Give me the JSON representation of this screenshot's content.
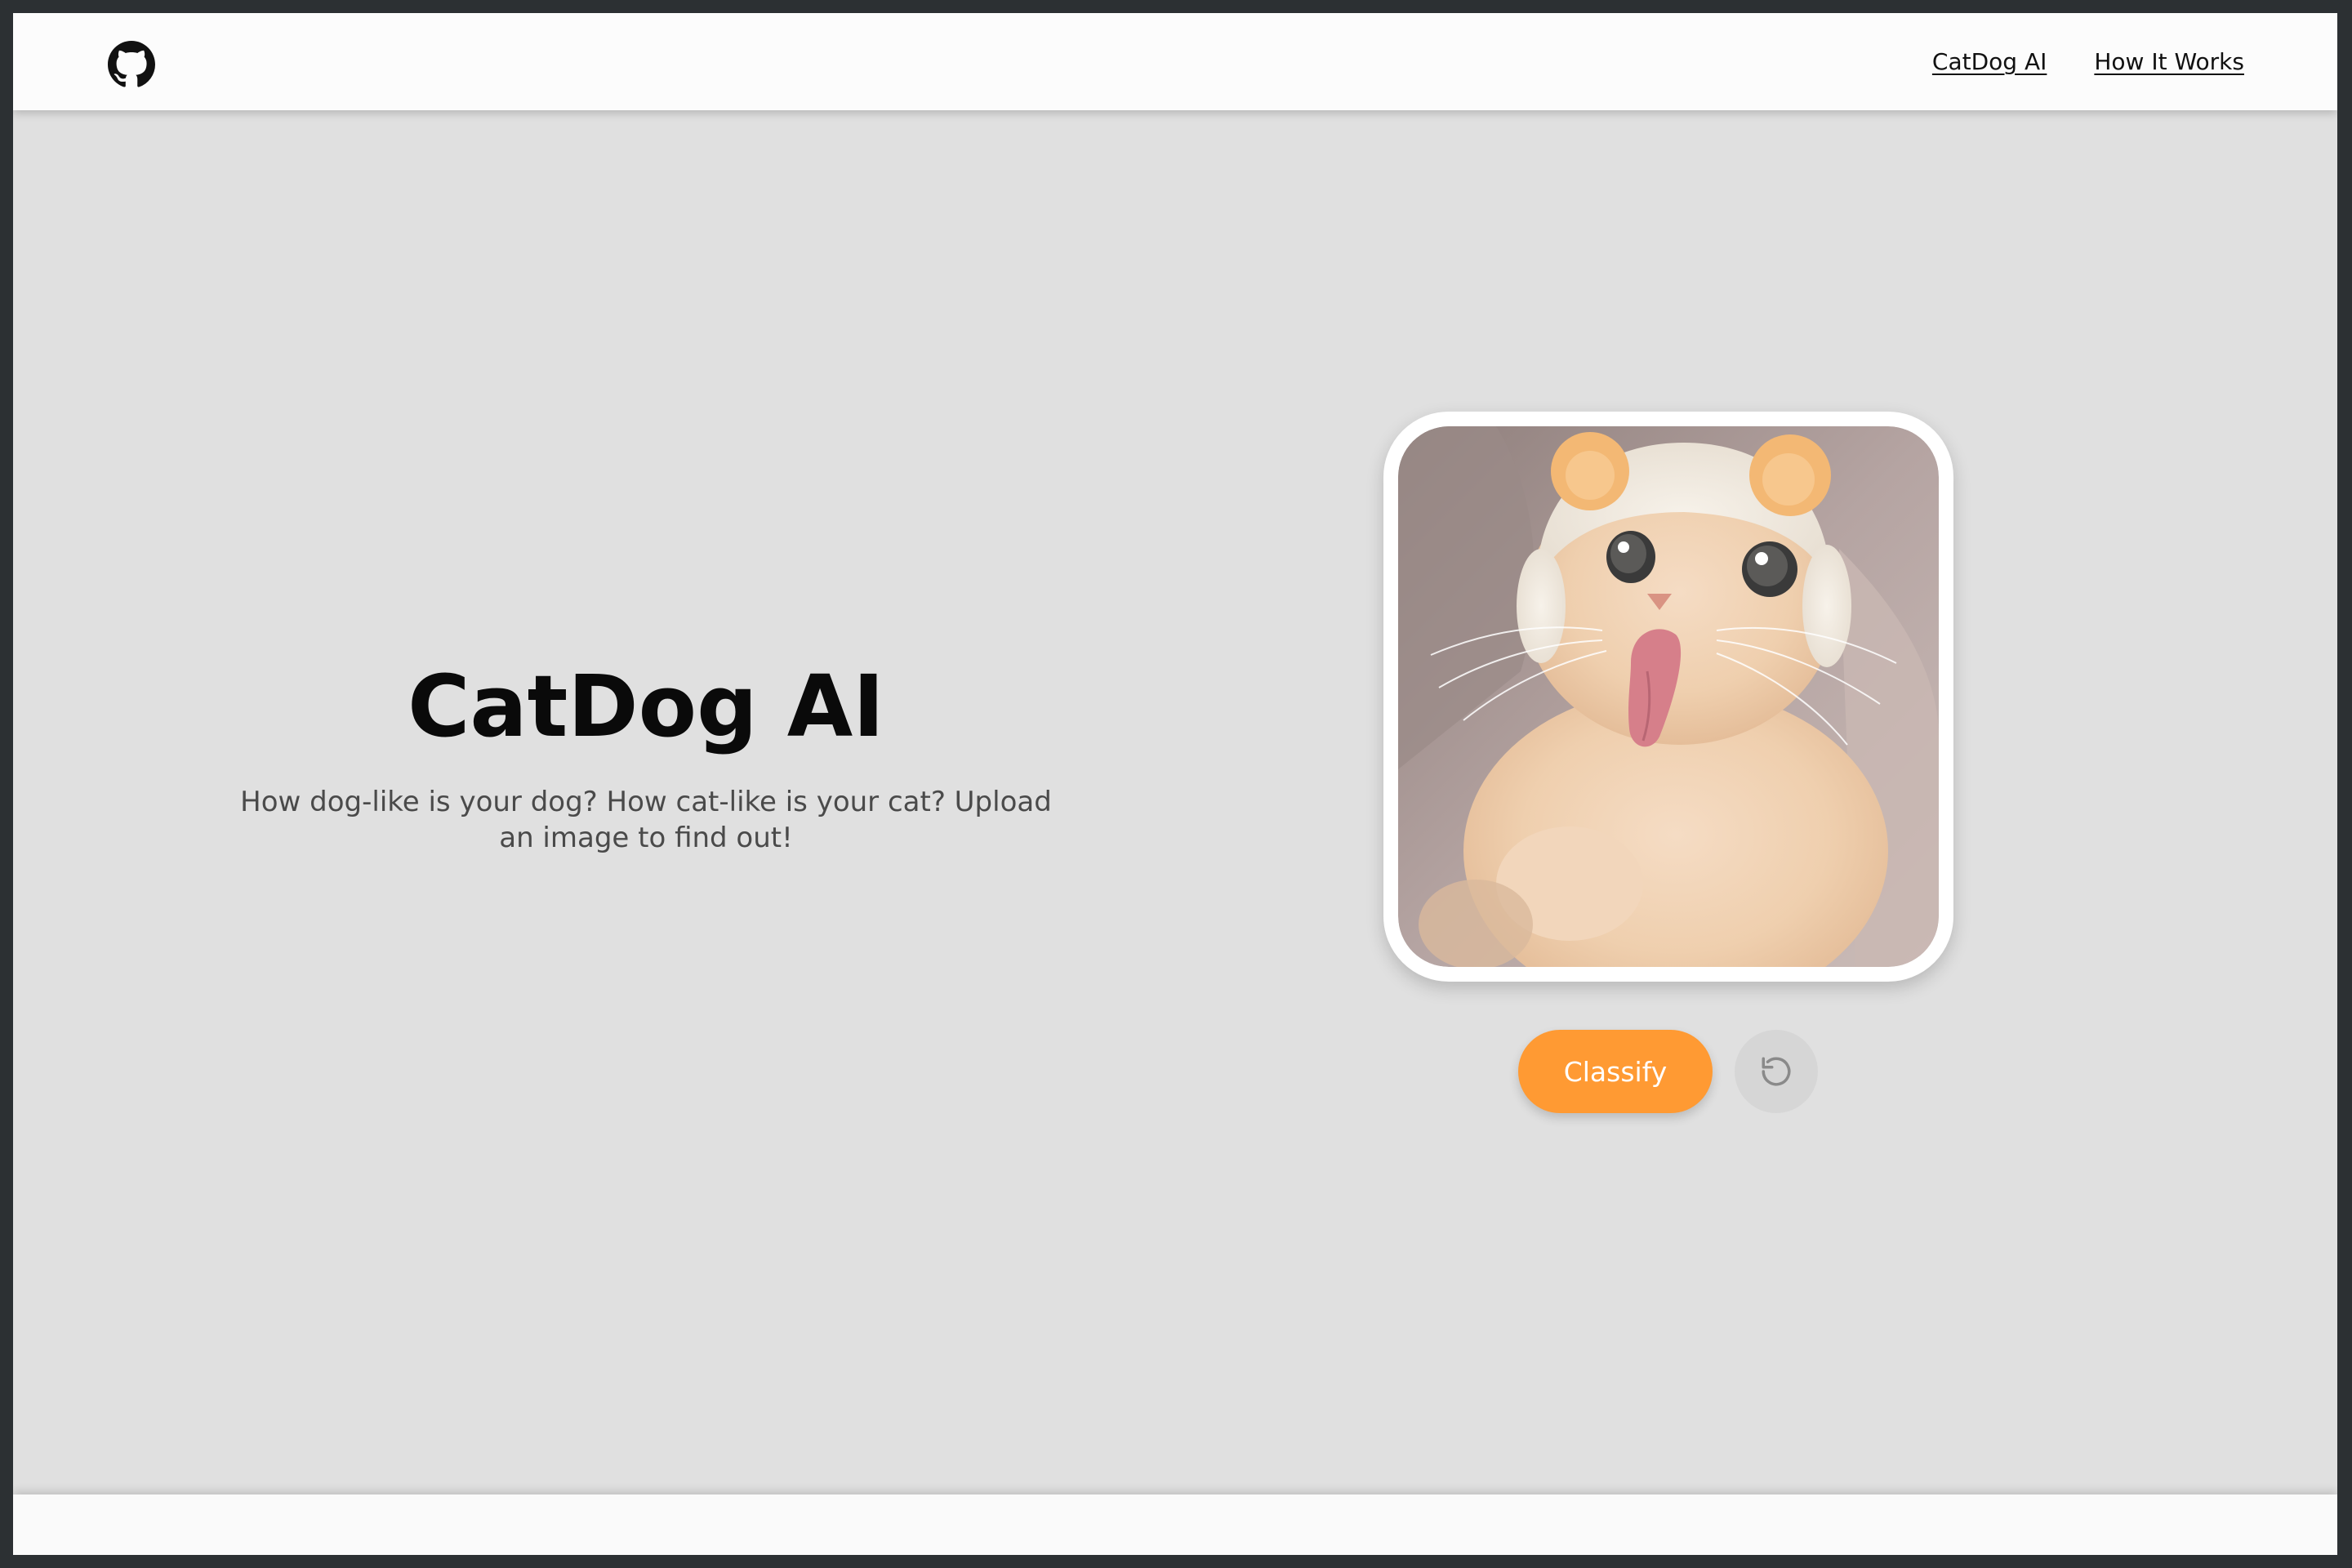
{
  "colors": {
    "page_background": "#e0e0e0",
    "navbar_background": "#fcfcfc",
    "accent_orange": "#ff9a33",
    "title_color": "#0a0a0a",
    "subtitle_color": "#4a4a4a",
    "reset_button_background": "#d6d6d6"
  },
  "navbar": {
    "logo_icon": "github-icon",
    "links": [
      {
        "label": "CatDog AI"
      },
      {
        "label": "How It Works"
      }
    ]
  },
  "hero": {
    "title": "CatDog AI",
    "subtitle": "How dog-like is your dog? How cat-like is your cat? Upload an image to find out!"
  },
  "uploader": {
    "preview_image": "cat-photo",
    "classify_label": "Classify",
    "reset_icon": "rotate-ccw-icon"
  }
}
